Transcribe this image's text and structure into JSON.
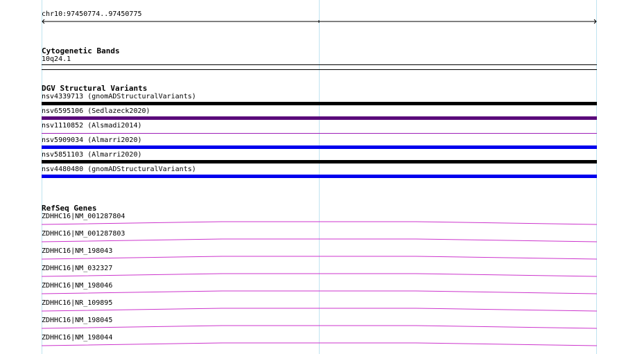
{
  "ruler": {
    "coordinates": "chr10:97450774..97450775"
  },
  "cytobands": {
    "title": "Cytogenetic Bands",
    "band": "10q24.1"
  },
  "dgv": {
    "title": "DGV Structural Variants",
    "variants": [
      {
        "label": "nsv4339713 (gnomADStructuralVariants)",
        "color": "#000000"
      },
      {
        "label": "nsv6595106 (Sedlazeck2020)",
        "color": "#5a0a7a"
      },
      {
        "label": "nsv1110852 (Alsmadi2014)",
        "color": "#9d1db8"
      },
      {
        "label": "nsv5909034 (Almarri2020)",
        "color": "#0000ee"
      },
      {
        "label": "nsv5851103 (Almarri2020)",
        "color": "#000000"
      },
      {
        "label": "nsv4480480 (gnomADStructuralVariants)",
        "color": "#0000ee"
      }
    ]
  },
  "refseq": {
    "title": "RefSeq Genes",
    "color": "#cc33cc",
    "genes": [
      "ZDHHC16|NM_001287804",
      "ZDHHC16|NM_001287803",
      "ZDHHC16|NM_198043",
      "ZDHHC16|NM_032327",
      "ZDHHC16|NM_198046",
      "ZDHHC16|NR_109895",
      "ZDHHC16|NM_198045",
      "ZDHHC16|NM_198044"
    ]
  }
}
